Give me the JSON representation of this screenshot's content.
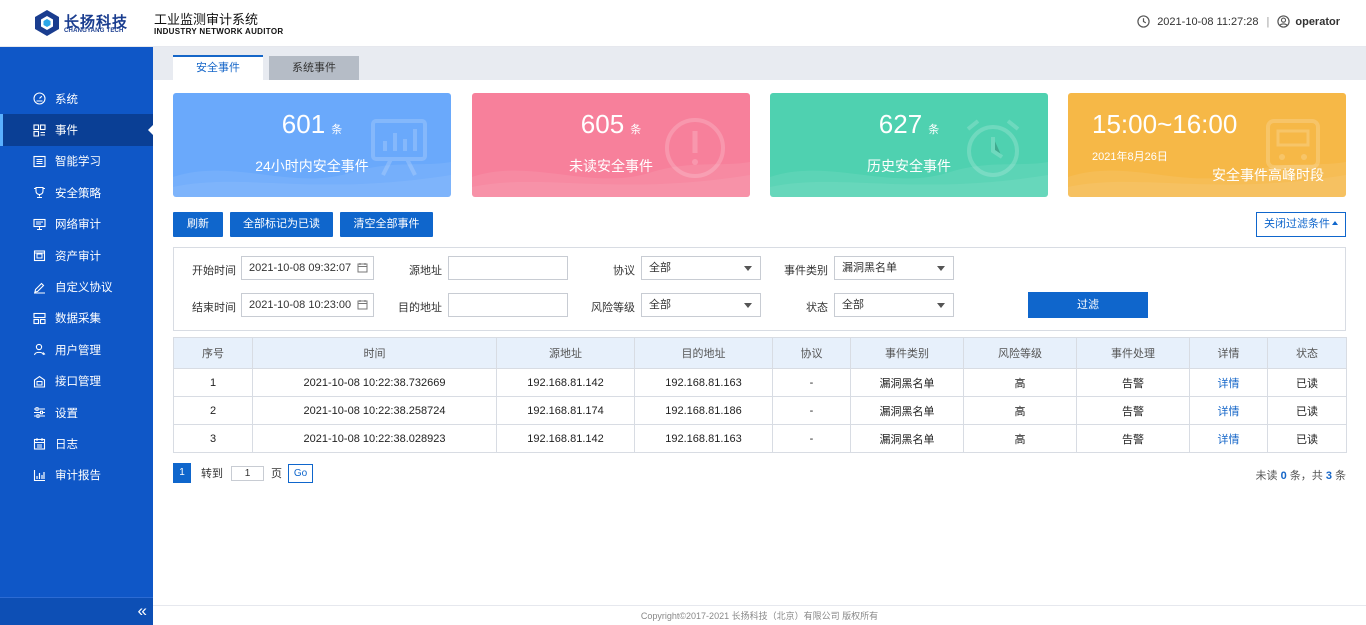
{
  "brand": {
    "logo_cn": "长扬科技",
    "logo_en": "CHANGYANG TECH",
    "system_title": "工业监测审计系统",
    "system_subtitle": "INDUSTRY NETWORK AUDITOR"
  },
  "header": {
    "datetime": "2021-10-08 11:27:28",
    "separator": "|",
    "username": "operator"
  },
  "sidebar": {
    "items": [
      {
        "label": "系统",
        "icon": "gauge-icon"
      },
      {
        "label": "事件",
        "icon": "event-list-icon",
        "active": true
      },
      {
        "label": "智能学习",
        "icon": "learning-icon"
      },
      {
        "label": "安全策略",
        "icon": "trophy-shield-icon"
      },
      {
        "label": "网络审计",
        "icon": "network-audit-icon"
      },
      {
        "label": "资产审计",
        "icon": "asset-icon"
      },
      {
        "label": "自定义协议",
        "icon": "edit-protocol-icon"
      },
      {
        "label": "数据采集",
        "icon": "data-collect-icon"
      },
      {
        "label": "用户管理",
        "icon": "user-icon"
      },
      {
        "label": "接口管理",
        "icon": "interface-icon"
      },
      {
        "label": "设置",
        "icon": "settings-sliders-icon"
      },
      {
        "label": "日志",
        "icon": "calendar-log-icon"
      },
      {
        "label": "审计报告",
        "icon": "chart-report-icon"
      }
    ],
    "collapse_glyph": "«"
  },
  "tabs": [
    {
      "label": "安全事件",
      "active": true
    },
    {
      "label": "系统事件",
      "active": false
    }
  ],
  "cards": {
    "c1": {
      "count": "601",
      "unit": "条",
      "label": "24小时内安全事件"
    },
    "c2": {
      "count": "605",
      "unit": "条",
      "label": "未读安全事件"
    },
    "c3": {
      "count": "627",
      "unit": "条",
      "label": "历史安全事件"
    },
    "c4": {
      "period": "15:00~16:00",
      "date": "2021年8月26日",
      "label": "安全事件高峰时段"
    }
  },
  "actions": {
    "refresh": "刷新",
    "mark_all_read": "全部标记为已读",
    "clear_all": "清空全部事件",
    "toggle_filter": "关闭过滤条件"
  },
  "filter": {
    "start_time_label": "开始时间",
    "start_time": "2021-10-08 09:32:07",
    "end_time_label": "结束时间",
    "end_time": "2021-10-08 10:23:00",
    "src_label": "源地址",
    "src_value": "",
    "dst_label": "目的地址",
    "dst_value": "",
    "protocol_label": "协议",
    "protocol_value": "全部",
    "risk_label": "风险等级",
    "risk_value": "全部",
    "category_label": "事件类别",
    "category_value": "漏洞黑名单",
    "status_label": "状态",
    "status_value": "全部",
    "submit": "过滤"
  },
  "table": {
    "headers": [
      "序号",
      "时间",
      "源地址",
      "目的地址",
      "协议",
      "事件类别",
      "风险等级",
      "事件处理",
      "详情",
      "状态"
    ],
    "rows": [
      [
        "1",
        "2021-10-08 10:22:38.732669",
        "192.168.81.142",
        "192.168.81.163",
        "-",
        "漏洞黑名单",
        "高",
        "告警",
        "详情",
        "已读"
      ],
      [
        "2",
        "2021-10-08 10:22:38.258724",
        "192.168.81.174",
        "192.168.81.186",
        "-",
        "漏洞黑名单",
        "高",
        "告警",
        "详情",
        "已读"
      ],
      [
        "3",
        "2021-10-08 10:22:38.028923",
        "192.168.81.142",
        "192.168.81.163",
        "-",
        "漏洞黑名单",
        "高",
        "告警",
        "详情",
        "已读"
      ]
    ]
  },
  "pager": {
    "current": "1",
    "goto_label": "转到",
    "goto_value": "1",
    "page_label": "页",
    "go": "Go"
  },
  "summary": {
    "unread_prefix": "未读",
    "unread": "0",
    "mid": "条，共",
    "total": "3",
    "suffix": "条"
  },
  "footer": {
    "copyright": "Copyright©2017-2021 长扬科技（北京）有限公司 版权所有"
  },
  "colors": {
    "sidebar": "#0f57c7",
    "primary": "#0f66cc",
    "card1": "#6aa9fb",
    "card2": "#f7809b",
    "card3": "#4fd1b0",
    "card4": "#f6b847"
  }
}
